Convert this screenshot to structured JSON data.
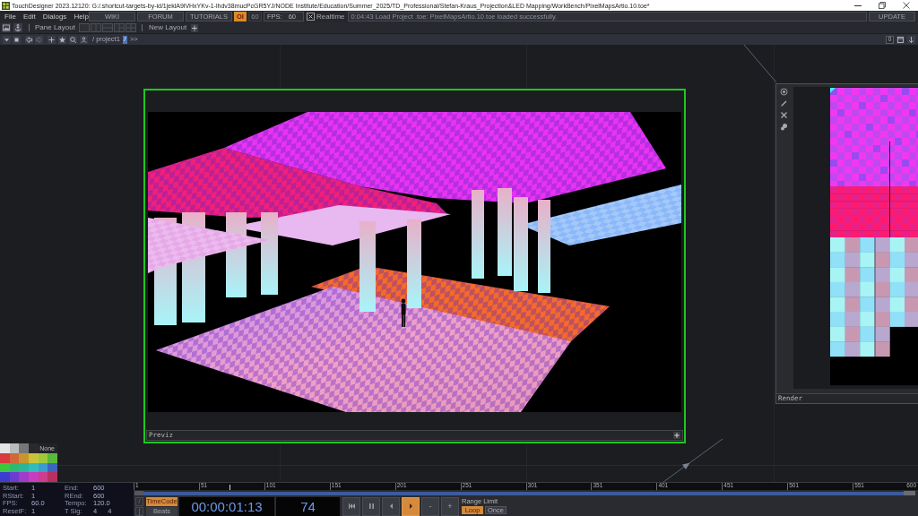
{
  "window": {
    "title": "TouchDesigner 2023.12120: G:/.shortcut-targets-by-id/1jeklA9lVHxYKv-1-lhdv38mucPcGR5YJ/NODE Institute/Education/Summer_2025/TD_Professional/Stefan-Kraus_Projection&LED Mapping/WorkBench/PixelMapsArtio.10.toe*"
  },
  "menu": [
    "File",
    "Edit",
    "Dialogs",
    "Help"
  ],
  "links": [
    "WIKI",
    "FORUM",
    "TUTORIALS"
  ],
  "status": {
    "indicator": "OI",
    "fps_limit": "60",
    "fps_label": "FPS:",
    "fps": "60",
    "realtime": {
      "label": "Realtime",
      "checked": true
    },
    "message": "0:04:43 Load Project .toe: PixelMapsArtio.10.toe loaded successfully.",
    "update": "UPDATE"
  },
  "pane_bar": {
    "label": "Pane Layout",
    "new_layout": "New Layout"
  },
  "path_bar": {
    "path": "/ project1",
    "current": "/",
    "more": ">>",
    "count": "0"
  },
  "nodes": [
    {
      "kind": "previz",
      "label": "Previz",
      "selected": true
    },
    {
      "kind": "render",
      "label": "Render",
      "selected": false
    }
  ],
  "palette": {
    "none_label": "None",
    "swatches": [
      {
        "color": "#e4e4e4"
      },
      {
        "color": "#bcbcbc"
      },
      {
        "color": "#777777"
      },
      {
        "color": "#2a2a2a"
      },
      {
        "color": "#d83c3c"
      },
      {
        "color": "#d0683a"
      },
      {
        "color": "#c8962e"
      },
      {
        "color": "#c8c43a"
      },
      {
        "color": "#a0c83c"
      },
      {
        "color": "#5ab83c"
      },
      {
        "color": "#3cc83c"
      },
      {
        "color": "#2eb870"
      },
      {
        "color": "#2ab59a"
      },
      {
        "color": "#30bcbc"
      },
      {
        "color": "#3c9cd0"
      },
      {
        "color": "#3c64c0"
      },
      {
        "color": "#3c3cd0"
      },
      {
        "color": "#6c3cd0"
      },
      {
        "color": "#a03cc8"
      },
      {
        "color": "#c83cc0"
      },
      {
        "color": "#d03c8c"
      },
      {
        "color": "#b83060"
      }
    ]
  },
  "time_info": [
    {
      "label": "Start:",
      "value": "1"
    },
    {
      "label": "End:",
      "value": "600"
    },
    {
      "label": "RStart:",
      "value": "1"
    },
    {
      "label": "REnd:",
      "value": "600"
    },
    {
      "label": "FPS:",
      "value": "60.0"
    },
    {
      "label": "Tempo:",
      "value": "120.0"
    },
    {
      "label": "ResetF:",
      "value": "1"
    },
    {
      "label": "T Sig:",
      "values": [
        "4",
        "4"
      ]
    }
  ],
  "timeline": {
    "ticks": [
      "1",
      "51",
      "101",
      "151",
      "201",
      "251",
      "301",
      "351",
      "401",
      "451",
      "501",
      "551",
      "600"
    ],
    "playhead": {
      "level": 0.122
    }
  },
  "view_toggles": [
    "/",
    "["
  ],
  "time_mode": [
    {
      "label": "TimeCode",
      "selected": true
    },
    {
      "label": "Beats",
      "selected": false
    }
  ],
  "timecode": "00:00:01:13",
  "frame": "74",
  "transport": [
    {
      "kind": "rewind",
      "selected": false
    },
    {
      "kind": "pause",
      "selected": false
    },
    {
      "kind": "step-back",
      "selected": false
    },
    {
      "kind": "play",
      "selected": true
    },
    {
      "kind": "text",
      "label": "-",
      "selected": false
    },
    {
      "kind": "text",
      "label": "+",
      "selected": false
    }
  ],
  "range_limit": {
    "label": "Range Limit",
    "options": [
      {
        "label": "Loop",
        "selected": true
      },
      {
        "label": "Once",
        "selected": false
      }
    ]
  }
}
